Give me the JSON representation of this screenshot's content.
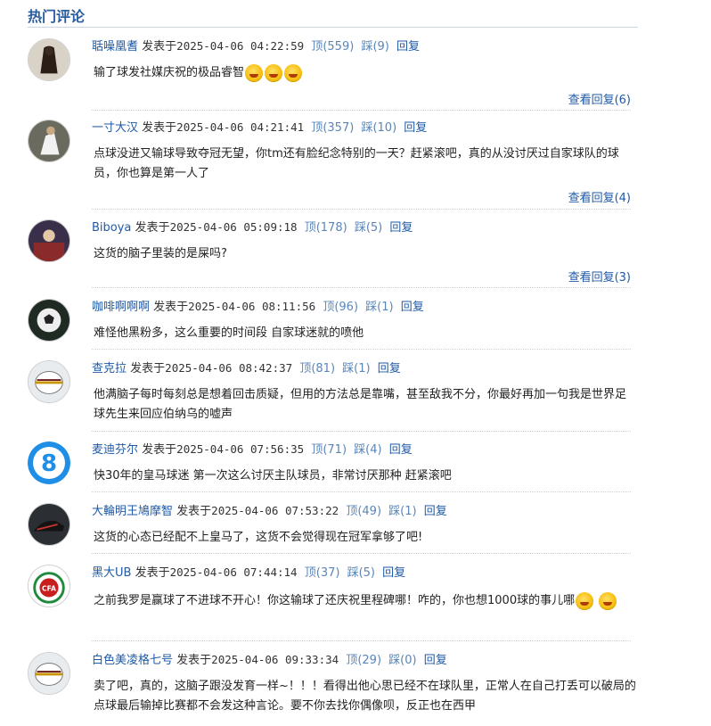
{
  "section": {
    "title": "热门评论"
  },
  "labels": {
    "posted": "发表于",
    "up": "顶",
    "down": "踩",
    "reply": "回复"
  },
  "comments": [
    {
      "user": "聒噪凰耆",
      "time": "2025-04-06 04:22:59",
      "up": "(559)",
      "down": "(9)",
      "text": "输了球发社媒庆祝的极品睿智",
      "emoji_count": 3,
      "view_replies": "查看回复(6)",
      "avatar_icon": "dark-figure-avatar-icon"
    },
    {
      "user": "一寸大汉",
      "time": "2025-04-06 04:21:41",
      "up": "(357)",
      "down": "(10)",
      "text": "点球没进又输球导致夺冠无望，你tm还有脸纪念特别的一天？赶紧滚吧，真的从没讨厌过自家球队的球员，你也算是第一人了",
      "view_replies": "查看回复(4)",
      "avatar_icon": "player-photo-avatar-icon"
    },
    {
      "user": "Biboya",
      "time": "2025-04-06 05:09:18",
      "up": "(178)",
      "down": "(5)",
      "text": "这货的脑子里装的是屎吗?",
      "view_replies": "查看回复(3)",
      "avatar_icon": "photo-avatar-icon"
    },
    {
      "user": "咖啡啊啊啊",
      "time": "2025-04-06 08:11:56",
      "up": "(96)",
      "down": "(1)",
      "text": "难怪他黑粉多，这么重要的时间段 自家球迷就的喷他",
      "avatar_icon": "soccer-ball-avatar-icon"
    },
    {
      "user": "查克拉",
      "time": "2025-04-06 08:42:37",
      "up": "(81)",
      "down": "(1)",
      "text": "他满脑子每时每刻总是想着回击质疑，但用的方法总是靠嘴，甚至敌我不分，你最好再加一句我是世界足球先生来回应伯纳乌的嘘声",
      "avatar_icon": "football-avatar-icon"
    },
    {
      "user": "麦迪芬尔",
      "time": "2025-04-06 07:56:35",
      "up": "(71)",
      "down": "(4)",
      "text": "快30年的皇马球迷 第一次这么讨厌主队球员，非常讨厌那种 赶紧滚吧",
      "avatar_icon": "number-eight-avatar-icon",
      "avatar_text": "8"
    },
    {
      "user": "大輪明王鳩摩智",
      "time": "2025-04-06 07:53:22",
      "up": "(49)",
      "down": "(1)",
      "text": "这货的心态已经配不上皇马了，这货不会觉得现在冠军拿够了吧!",
      "avatar_icon": "shoe-avatar-icon"
    },
    {
      "user": "黑大UB",
      "time": "2025-04-06 07:44:14",
      "up": "(37)",
      "down": "(5)",
      "text": "之前我罗是赢球了不进球不开心！你这输球了还庆祝里程碑哪！咋的，你也想1000球的事儿哪",
      "emoji_count": 2,
      "avatar_icon": "cfa-badge-avatar-icon",
      "avatar_text": "CFA"
    },
    {
      "user": "白色美凌格七号",
      "time": "2025-04-06 09:33:34",
      "up": "(29)",
      "down": "(0)",
      "text": "卖了吧，真的，这脑子跟没发育一样~！！！看得出他心思已经不在球队里，正常人在自己打丢可以破局的点球最后输掉比赛都不会发这种言论。要不你去找你偶像呗，反正也在西甲",
      "avatar_icon": "football-avatar-icon"
    }
  ]
}
